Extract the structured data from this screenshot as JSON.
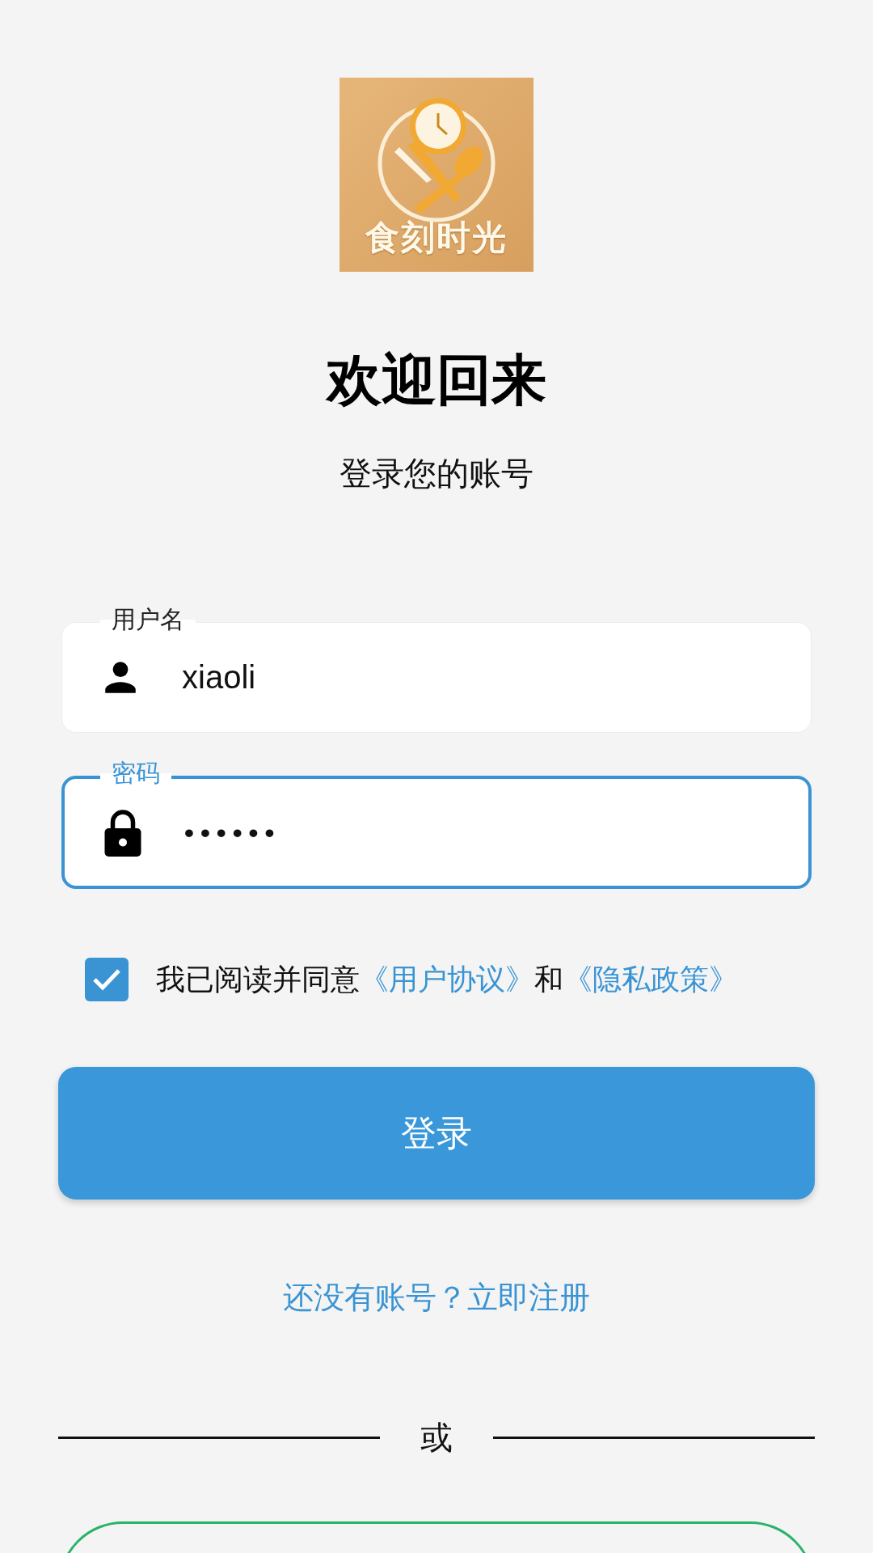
{
  "logo": {
    "text": "食刻时光"
  },
  "title": "欢迎回来",
  "subtitle": "登录您的账号",
  "fields": [
    {
      "kind": "user",
      "label": "用户名",
      "value": "xiaoli",
      "focused": false
    },
    {
      "kind": "lock",
      "label": "密码",
      "value": "••••••",
      "focused": true
    }
  ],
  "agreement": {
    "checked": true,
    "parts": [
      {
        "kind": "text",
        "text": "我已阅读并同意"
      },
      {
        "kind": "link",
        "text": "《用户协议》"
      },
      {
        "kind": "text",
        "text": "和"
      },
      {
        "kind": "link",
        "text": "《隐私政策》"
      }
    ]
  },
  "login_button": "登录",
  "register_link": "还没有账号？立即注册",
  "divider": "或"
}
